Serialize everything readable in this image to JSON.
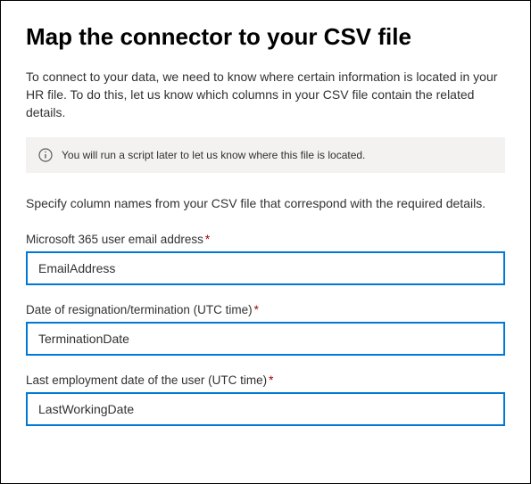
{
  "title": "Map the connector to your CSV file",
  "description": "To connect to your data, we need to know where certain information is located in your HR file. To do this, let us know which columns in your CSV file contain the related details.",
  "info_banner": {
    "text": "You will run a script later to let us know where this file is located."
  },
  "instruction": "Specify column names from your CSV file that correspond with the required details.",
  "fields": [
    {
      "label": "Microsoft 365 user email address",
      "required": true,
      "value": "EmailAddress"
    },
    {
      "label": "Date of resignation/termination (UTC time)",
      "required": true,
      "value": "TerminationDate"
    },
    {
      "label": "Last employment date of the user (UTC time)",
      "required": true,
      "value": "LastWorkingDate"
    }
  ]
}
